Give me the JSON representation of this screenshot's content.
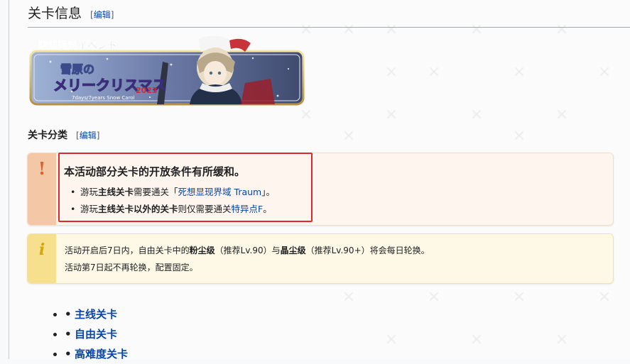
{
  "section": {
    "title": "关卡信息",
    "edit": "编辑"
  },
  "banner": {
    "top_text": "期間限定イベント",
    "logo_text_a": "雪原の",
    "logo_text_b": "メリークリスマス",
    "logo_number": "2023",
    "logo_sub": "7days/7years Snow Carol"
  },
  "subsection": {
    "title": "关卡分类",
    "edit": "编辑"
  },
  "warn": {
    "heading": "本活动部分关卡的开放条件有所缓和。",
    "item1": {
      "pre": "游玩",
      "bold": "主线关卡",
      "mid": "需要通关「",
      "link": "死想显现界域 Traum",
      "post": "」。"
    },
    "item2": {
      "pre": "游玩",
      "bold": "主线关卡以外的关卡",
      "mid": "则仅需要通关",
      "link": "特异点F",
      "post": "。"
    }
  },
  "info": {
    "line1_a": "活动开启后7日内，自由关卡中的",
    "line1_b": "粉尘级",
    "line1_c": "（推荐Lv.90）与",
    "line1_d": "晶尘级",
    "line1_e": "（推荐Lv.90+）将会每日轮换。",
    "line2": "活动第7日起不再轮换，配置固定。"
  },
  "links": [
    "主线关卡",
    "自由关卡",
    "高难度关卡"
  ],
  "colors": {
    "link": "#0645ad",
    "warn_strip": "#f4c7a6",
    "warn_bg": "#fef6ee",
    "info_strip": "#f6e08e",
    "info_bg": "#fef9e7",
    "highlight_frame": "#e02828"
  }
}
